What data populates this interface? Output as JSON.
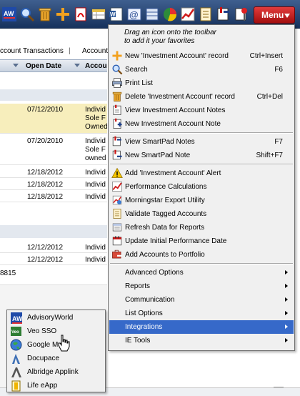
{
  "toolbar": {
    "icons": [
      {
        "name": "advisoryworld-logo-icon"
      },
      {
        "name": "search-icon"
      },
      {
        "name": "trash-icon"
      },
      {
        "name": "add-plus-icon"
      },
      {
        "name": "pdf-icon"
      },
      {
        "name": "table-icon"
      },
      {
        "name": "word-icon"
      },
      {
        "name": "email-icon"
      },
      {
        "name": "database-icon"
      },
      {
        "name": "pie-chart-icon"
      },
      {
        "name": "performance-chart-icon"
      },
      {
        "name": "checklist-icon"
      },
      {
        "name": "smartpad-icon"
      },
      {
        "name": "pin-icon"
      }
    ],
    "menu_label": "Menu"
  },
  "background": {
    "tabs": [
      "ccount Transactions",
      "|",
      "Account"
    ],
    "columns": {
      "open_date": "Open Date",
      "account": "Accou"
    },
    "rows": [
      {
        "date": "07/12/2010",
        "lines": [
          "Individ",
          "Sole F",
          "Owned"
        ]
      },
      {
        "date": "07/20/2010",
        "lines": [
          "Individ",
          "Sole F",
          "owned"
        ]
      },
      {
        "date": "12/18/2012",
        "lines": [
          "Individ"
        ]
      },
      {
        "date": "12/18/2012",
        "lines": [
          "Individ"
        ]
      },
      {
        "date": "12/18/2012",
        "lines": [
          "Individ"
        ]
      },
      {
        "date": "12/12/2012",
        "lines": [
          "Individ"
        ]
      },
      {
        "date": "12/12/2012",
        "lines": [
          "Individ"
        ]
      }
    ],
    "count_text": "8815"
  },
  "menu": {
    "hint_line1": "Drag an icon onto the toolbar",
    "hint_line2": "to add it your favorites",
    "groups": [
      [
        {
          "label": "New 'Investment Account' record",
          "shortcut": "Ctrl+Insert",
          "icon": "add-plus-icon"
        },
        {
          "label": "Search",
          "shortcut": "F6",
          "icon": "search-icon"
        },
        {
          "label": "Print List",
          "shortcut": "",
          "icon": "printer-icon"
        },
        {
          "label": "Delete 'Investment Account' record",
          "shortcut": "Ctrl+Del",
          "icon": "trash-icon"
        },
        {
          "label": "View Investment Account Notes",
          "shortcut": "",
          "icon": "notes-icon"
        },
        {
          "label": "New Investment Account Note",
          "shortcut": "",
          "icon": "new-note-icon"
        }
      ],
      [
        {
          "label": "View SmartPad Notes",
          "shortcut": "F7",
          "icon": "smartpad-icon"
        },
        {
          "label": "New SmartPad Note",
          "shortcut": "Shift+F7",
          "icon": "new-smartpad-icon"
        }
      ],
      [
        {
          "label": "Add 'Investment Account' Alert",
          "shortcut": "",
          "icon": "alert-icon"
        },
        {
          "label": "Performance Calculations",
          "shortcut": "",
          "icon": "performance-chart-icon"
        },
        {
          "label": "Morningstar Export Utility",
          "shortcut": "",
          "icon": "export-icon"
        },
        {
          "label": "Validate Tagged Accounts",
          "shortcut": "",
          "icon": "checklist-icon"
        },
        {
          "label": "Refresh Data for Reports",
          "shortcut": "",
          "icon": "refresh-icon"
        },
        {
          "label": "Update Initial Performance Date",
          "shortcut": "",
          "icon": "calendar-icon"
        },
        {
          "label": "Add Accounts to Portfolio",
          "shortcut": "",
          "icon": "portfolio-add-icon"
        }
      ],
      [
        {
          "label": "Advanced Options",
          "submenu": true
        },
        {
          "label": "Reports",
          "submenu": true
        },
        {
          "label": "Communication",
          "submenu": true
        },
        {
          "label": "List Options",
          "submenu": true
        },
        {
          "label": "Integrations",
          "submenu": true,
          "active": true
        },
        {
          "label": "IE Tools",
          "submenu": true
        }
      ]
    ]
  },
  "submenu": {
    "items": [
      {
        "label": "AdvisoryWorld",
        "icon": "advisoryworld-logo-icon"
      },
      {
        "label": "Veo SSO",
        "icon": "veo-logo-icon"
      },
      {
        "label": "Google Maps",
        "icon": "globe-icon"
      },
      {
        "label": "Docupace",
        "icon": "docupace-logo-icon"
      },
      {
        "label": "Albridge Applink",
        "icon": "albridge-logo-icon"
      },
      {
        "label": "Life eApp",
        "icon": "life-eapp-icon"
      }
    ]
  },
  "colors": {
    "toolbar": "#17325d",
    "menu_button": "#c41a1a",
    "highlight": "#3669c9",
    "row_highlight": "#f7eebc"
  }
}
